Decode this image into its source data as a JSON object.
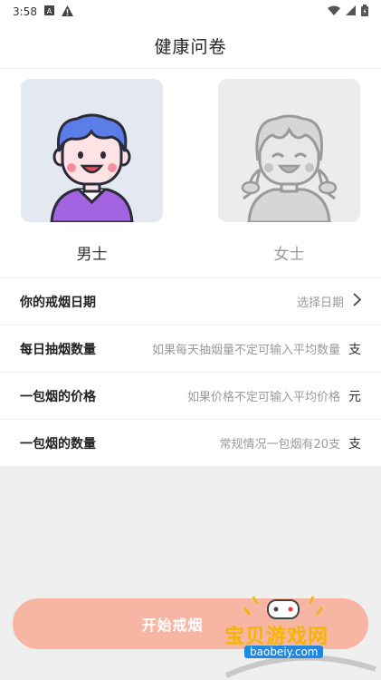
{
  "status_bar": {
    "time": "3:58"
  },
  "header": {
    "title": "健康问卷"
  },
  "gender": {
    "male_label": "男士",
    "female_label": "女士",
    "selected": "male"
  },
  "form": {
    "rows": [
      {
        "label": "你的戒烟日期",
        "value": "选择日期",
        "unit": ""
      },
      {
        "label": "每日抽烟数量",
        "value": "如果每天抽烟量不定可输入平均数量",
        "unit": "支"
      },
      {
        "label": "一包烟的价格",
        "value": "如果价格不定可输入平均价格",
        "unit": "元"
      },
      {
        "label": "一包烟的数量",
        "value": "常规情况一包烟有20支",
        "unit": "支"
      }
    ]
  },
  "start_button": {
    "label": "开始戒烟"
  },
  "watermark": {
    "text": "宝贝游戏网",
    "url": "baobeiy.com"
  },
  "colors": {
    "button": "#f7b6a4",
    "male_hair": "#5b7de8",
    "male_shirt": "#a463e0"
  }
}
